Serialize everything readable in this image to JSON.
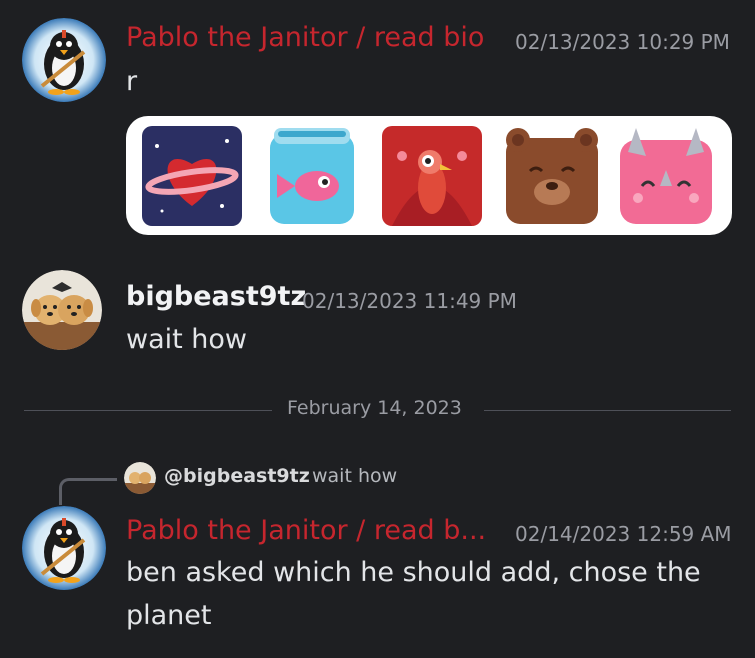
{
  "messages": [
    {
      "username": "Pablo the Janitor / read bio",
      "timestamp": "02/13/2023 10:29 PM",
      "text": "r",
      "stickers": [
        "planet-heart-sticker",
        "fish-jar-sticker",
        "peacock-sticker",
        "bear-sticker",
        "triceratops-sticker"
      ]
    },
    {
      "username": "bigbeast9tz",
      "timestamp": "02/13/2023 11:49 PM",
      "text": "wait how"
    },
    {
      "username": "Pablo the Janitor / read b...",
      "timestamp": "02/14/2023 12:59 AM",
      "text_line1": "ben asked which he should add, chose the",
      "text_line2": "planet",
      "reply": {
        "mention": "@bigbeast9tz",
        "text": "wait how"
      }
    }
  ],
  "divider": {
    "date": "February 14, 2023"
  },
  "colors": {
    "background": "#1e1f22",
    "role_red": "#c6262e",
    "timestamp": "#9a9ca3",
    "text": "#e3e5e8"
  }
}
